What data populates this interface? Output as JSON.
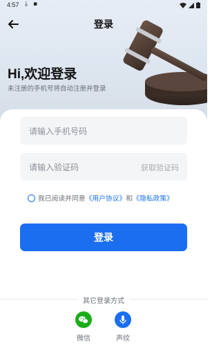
{
  "status_bar": {
    "time": "4:57"
  },
  "header": {
    "title": "登录",
    "back_icon": "arrow-left-icon"
  },
  "hero": {
    "greeting": "Hi,欢迎登录",
    "subtitle": "未注册的手机号将自动注册并登录"
  },
  "form": {
    "phone_placeholder": "请输入手机号码",
    "code_placeholder": "请输入验证码",
    "get_code_label": "获取验证码"
  },
  "agreement": {
    "prefix": "我已阅读并同意",
    "user_agreement": "《用户协议》",
    "and": "和",
    "privacy_policy": "《隐私政策》"
  },
  "login_button": {
    "label": "登录"
  },
  "other_login": {
    "title": "其它登录方式",
    "options": [
      {
        "label": "微信",
        "icon": "wechat-icon",
        "color": "#1aad19"
      },
      {
        "label": "声纹",
        "icon": "microphone-icon",
        "color": "#1b6ef0"
      }
    ]
  },
  "colors": {
    "accent": "#1b6ef0"
  }
}
